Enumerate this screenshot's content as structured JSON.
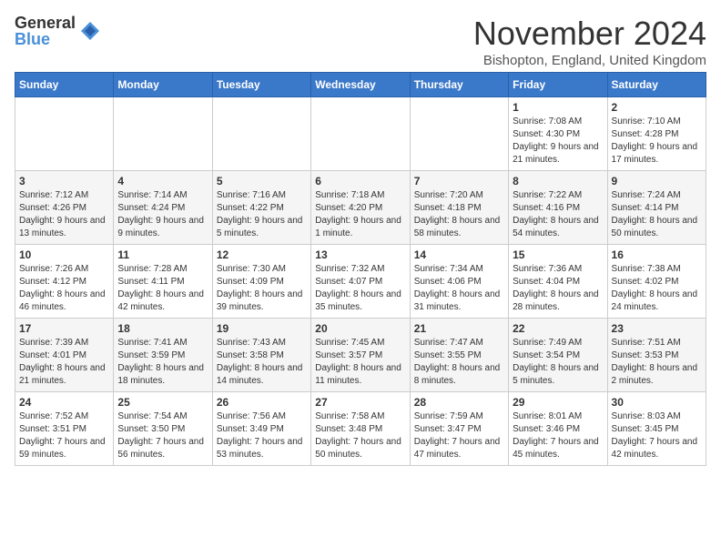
{
  "logo": {
    "general": "General",
    "blue": "Blue"
  },
  "title": "November 2024",
  "subtitle": "Bishopton, England, United Kingdom",
  "days_of_week": [
    "Sunday",
    "Monday",
    "Tuesday",
    "Wednesday",
    "Thursday",
    "Friday",
    "Saturday"
  ],
  "weeks": [
    [
      {
        "day": "",
        "info": ""
      },
      {
        "day": "",
        "info": ""
      },
      {
        "day": "",
        "info": ""
      },
      {
        "day": "",
        "info": ""
      },
      {
        "day": "",
        "info": ""
      },
      {
        "day": "1",
        "info": "Sunrise: 7:08 AM\nSunset: 4:30 PM\nDaylight: 9 hours and 21 minutes."
      },
      {
        "day": "2",
        "info": "Sunrise: 7:10 AM\nSunset: 4:28 PM\nDaylight: 9 hours and 17 minutes."
      }
    ],
    [
      {
        "day": "3",
        "info": "Sunrise: 7:12 AM\nSunset: 4:26 PM\nDaylight: 9 hours and 13 minutes."
      },
      {
        "day": "4",
        "info": "Sunrise: 7:14 AM\nSunset: 4:24 PM\nDaylight: 9 hours and 9 minutes."
      },
      {
        "day": "5",
        "info": "Sunrise: 7:16 AM\nSunset: 4:22 PM\nDaylight: 9 hours and 5 minutes."
      },
      {
        "day": "6",
        "info": "Sunrise: 7:18 AM\nSunset: 4:20 PM\nDaylight: 9 hours and 1 minute."
      },
      {
        "day": "7",
        "info": "Sunrise: 7:20 AM\nSunset: 4:18 PM\nDaylight: 8 hours and 58 minutes."
      },
      {
        "day": "8",
        "info": "Sunrise: 7:22 AM\nSunset: 4:16 PM\nDaylight: 8 hours and 54 minutes."
      },
      {
        "day": "9",
        "info": "Sunrise: 7:24 AM\nSunset: 4:14 PM\nDaylight: 8 hours and 50 minutes."
      }
    ],
    [
      {
        "day": "10",
        "info": "Sunrise: 7:26 AM\nSunset: 4:12 PM\nDaylight: 8 hours and 46 minutes."
      },
      {
        "day": "11",
        "info": "Sunrise: 7:28 AM\nSunset: 4:11 PM\nDaylight: 8 hours and 42 minutes."
      },
      {
        "day": "12",
        "info": "Sunrise: 7:30 AM\nSunset: 4:09 PM\nDaylight: 8 hours and 39 minutes."
      },
      {
        "day": "13",
        "info": "Sunrise: 7:32 AM\nSunset: 4:07 PM\nDaylight: 8 hours and 35 minutes."
      },
      {
        "day": "14",
        "info": "Sunrise: 7:34 AM\nSunset: 4:06 PM\nDaylight: 8 hours and 31 minutes."
      },
      {
        "day": "15",
        "info": "Sunrise: 7:36 AM\nSunset: 4:04 PM\nDaylight: 8 hours and 28 minutes."
      },
      {
        "day": "16",
        "info": "Sunrise: 7:38 AM\nSunset: 4:02 PM\nDaylight: 8 hours and 24 minutes."
      }
    ],
    [
      {
        "day": "17",
        "info": "Sunrise: 7:39 AM\nSunset: 4:01 PM\nDaylight: 8 hours and 21 minutes."
      },
      {
        "day": "18",
        "info": "Sunrise: 7:41 AM\nSunset: 3:59 PM\nDaylight: 8 hours and 18 minutes."
      },
      {
        "day": "19",
        "info": "Sunrise: 7:43 AM\nSunset: 3:58 PM\nDaylight: 8 hours and 14 minutes."
      },
      {
        "day": "20",
        "info": "Sunrise: 7:45 AM\nSunset: 3:57 PM\nDaylight: 8 hours and 11 minutes."
      },
      {
        "day": "21",
        "info": "Sunrise: 7:47 AM\nSunset: 3:55 PM\nDaylight: 8 hours and 8 minutes."
      },
      {
        "day": "22",
        "info": "Sunrise: 7:49 AM\nSunset: 3:54 PM\nDaylight: 8 hours and 5 minutes."
      },
      {
        "day": "23",
        "info": "Sunrise: 7:51 AM\nSunset: 3:53 PM\nDaylight: 8 hours and 2 minutes."
      }
    ],
    [
      {
        "day": "24",
        "info": "Sunrise: 7:52 AM\nSunset: 3:51 PM\nDaylight: 7 hours and 59 minutes."
      },
      {
        "day": "25",
        "info": "Sunrise: 7:54 AM\nSunset: 3:50 PM\nDaylight: 7 hours and 56 minutes."
      },
      {
        "day": "26",
        "info": "Sunrise: 7:56 AM\nSunset: 3:49 PM\nDaylight: 7 hours and 53 minutes."
      },
      {
        "day": "27",
        "info": "Sunrise: 7:58 AM\nSunset: 3:48 PM\nDaylight: 7 hours and 50 minutes."
      },
      {
        "day": "28",
        "info": "Sunrise: 7:59 AM\nSunset: 3:47 PM\nDaylight: 7 hours and 47 minutes."
      },
      {
        "day": "29",
        "info": "Sunrise: 8:01 AM\nSunset: 3:46 PM\nDaylight: 7 hours and 45 minutes."
      },
      {
        "day": "30",
        "info": "Sunrise: 8:03 AM\nSunset: 3:45 PM\nDaylight: 7 hours and 42 minutes."
      }
    ]
  ]
}
